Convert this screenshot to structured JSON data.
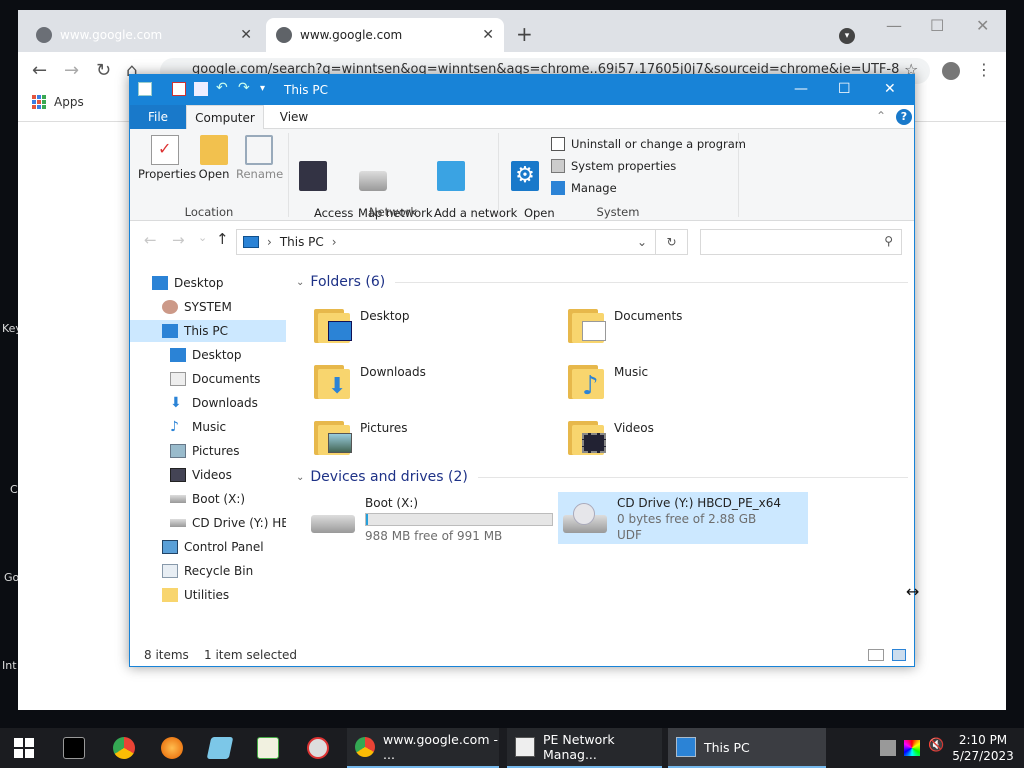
{
  "desktop": {
    "fragments": [
      "Key",
      "C",
      "Go",
      "Int"
    ]
  },
  "chrome": {
    "tabs": [
      {
        "title": "www.google.com",
        "close": "✕"
      },
      {
        "title": "www.google.com",
        "close": "✕"
      }
    ],
    "new_tab": "+",
    "window_controls": {
      "minimize": "—",
      "maximize": "☐",
      "close": "✕"
    },
    "nav": {
      "back": "←",
      "forward": "→",
      "reload": "↻",
      "home": "⌂"
    },
    "url": "google.com/search?q=winntsen&oq=winntsen&aqs=chrome..69i57.17605j0j7&sourceid=chrome&ie=UTF-8",
    "star": "☆",
    "menu": "⋮",
    "bookmarks": {
      "apps_label": "Apps"
    }
  },
  "explorer": {
    "title": "This PC",
    "window_controls": {
      "minimize": "—",
      "maximize": "☐",
      "close": "✕"
    },
    "ribbon_tabs": [
      "File",
      "Computer",
      "View"
    ],
    "help": "?",
    "collapse": "⌃",
    "location_group": {
      "label": "Location",
      "buttons": [
        {
          "label": "Properties"
        },
        {
          "label": "Open"
        },
        {
          "label": "Rename"
        }
      ]
    },
    "network_group": {
      "label": "Network",
      "buttons": [
        {
          "label": "Access\nmedia ▾"
        },
        {
          "label": "Map network\ndrive ▾"
        },
        {
          "label": "Add a network\nlocation"
        }
      ]
    },
    "system_group": {
      "label": "System",
      "open_settings": "Open\nSettings",
      "items": [
        "Uninstall or change a program",
        "System properties",
        "Manage"
      ]
    },
    "address": {
      "back": "←",
      "forward": "→",
      "recent": "⌄",
      "up": "↑",
      "path": "This PC",
      "sep1": "›",
      "sep2": "›",
      "dropdown": "⌄",
      "refresh": "↻",
      "search_icon": "⚲"
    },
    "nav_pane": [
      "Desktop",
      "SYSTEM",
      "This PC",
      "Desktop",
      "Documents",
      "Downloads",
      "Music",
      "Pictures",
      "Videos",
      "Boot (X:)",
      "CD Drive (Y:) HBC",
      "Control Panel",
      "Recycle Bin",
      "Utilities"
    ],
    "folders_header": "Folders (6)",
    "folders": [
      "Desktop",
      "Documents",
      "Downloads",
      "Music",
      "Pictures",
      "Videos"
    ],
    "drives_header": "Devices and drives (2)",
    "drives": [
      {
        "name": "Boot (X:)",
        "free": "988 MB free of 991 MB",
        "used_fraction": 0.003
      },
      {
        "name": "CD Drive (Y:) HBCD_PE_x64",
        "free": "0 bytes free of 2.88 GB",
        "fs": "UDF"
      }
    ],
    "status": {
      "items": "8 items",
      "selected": "1 item selected"
    }
  },
  "taskbar": {
    "buttons": [
      {
        "label": "www.google.com - ..."
      },
      {
        "label": "PE Network Manag..."
      },
      {
        "label": "This PC"
      }
    ],
    "clock": {
      "time": "2:10 PM",
      "date": "5/27/2023"
    }
  },
  "colors": {
    "accent": "#1883d7",
    "selection": "#cce8ff",
    "taskbar": "#1b1c20",
    "chrome_frame": "#dee1e6"
  }
}
